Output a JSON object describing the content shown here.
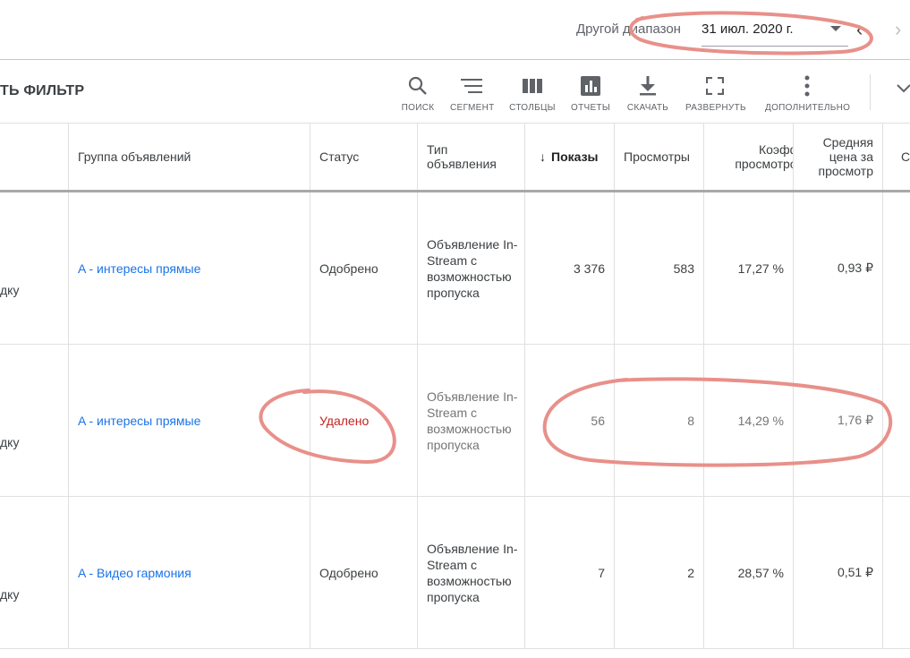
{
  "date_bar": {
    "range_label": "Другой диапазон",
    "date_value": "31 июл. 2020 г.",
    "prev_icon": "chevron-left-icon",
    "next_icon": "chevron-right-icon"
  },
  "toolbar": {
    "filter_label": "ТЬ ФИЛЬТР",
    "tools": [
      {
        "label": "ПОИСК",
        "icon": "search-icon"
      },
      {
        "label": "СЕГМЕНТ",
        "icon": "segment-icon"
      },
      {
        "label": "СТОЛБЦЫ",
        "icon": "columns-icon"
      },
      {
        "label": "ОТЧЕТЫ",
        "icon": "reports-icon"
      },
      {
        "label": "СКАЧАТЬ",
        "icon": "download-icon"
      },
      {
        "label": "РАЗВЕРНУТЬ",
        "icon": "fullscreen-icon"
      },
      {
        "label": "ДОПОЛНИТЕЛЬНО",
        "icon": "more-vert-icon"
      }
    ]
  },
  "table": {
    "headers": {
      "ad_group": "Группа объявлений",
      "status": "Статус",
      "ad_type_1": "Тип",
      "ad_type_2": "объявления",
      "impressions": "Показы",
      "views": "Просмотры",
      "view_rate_1": "Коэфф.",
      "view_rate_2": "просмотров",
      "avg_cpv_1": "Средняя",
      "avg_cpv_2": "цена за",
      "avg_cpv_3": "просмотр",
      "next_col": "С"
    },
    "rows": [
      {
        "lead": "дку",
        "ad_group": "A - интересы прямые",
        "status": "Одобрено",
        "ad_type_1": "Объявление In-",
        "ad_type_2": "Stream с",
        "ad_type_3": "возможностью",
        "ad_type_4": "пропуска",
        "impressions": "3 376",
        "views": "583",
        "view_rate": "17,27 %",
        "avg_cpv": "0,93 ₽"
      },
      {
        "lead": "дку",
        "ad_group": "A - интересы прямые",
        "status": "Удалено",
        "ad_type_1": "Объявление In-",
        "ad_type_2": "Stream с",
        "ad_type_3": "возможностью",
        "ad_type_4": "пропуска",
        "impressions": "56",
        "views": "8",
        "view_rate": "14,29 %",
        "avg_cpv": "1,76 ₽"
      },
      {
        "lead": "дку",
        "ad_group": "A - Видео гармония",
        "status": "Одобрено",
        "ad_type_1": "Объявление In-",
        "ad_type_2": "Stream с",
        "ad_type_3": "возможностью",
        "ad_type_4": "пропуска",
        "impressions": "7",
        "views": "2",
        "view_rate": "28,57 %",
        "avg_cpv": "0,51 ₽"
      }
    ]
  },
  "colors": {
    "link": "#1a73e8",
    "removed_status": "#c5221f",
    "annotation": "#e8908a"
  }
}
